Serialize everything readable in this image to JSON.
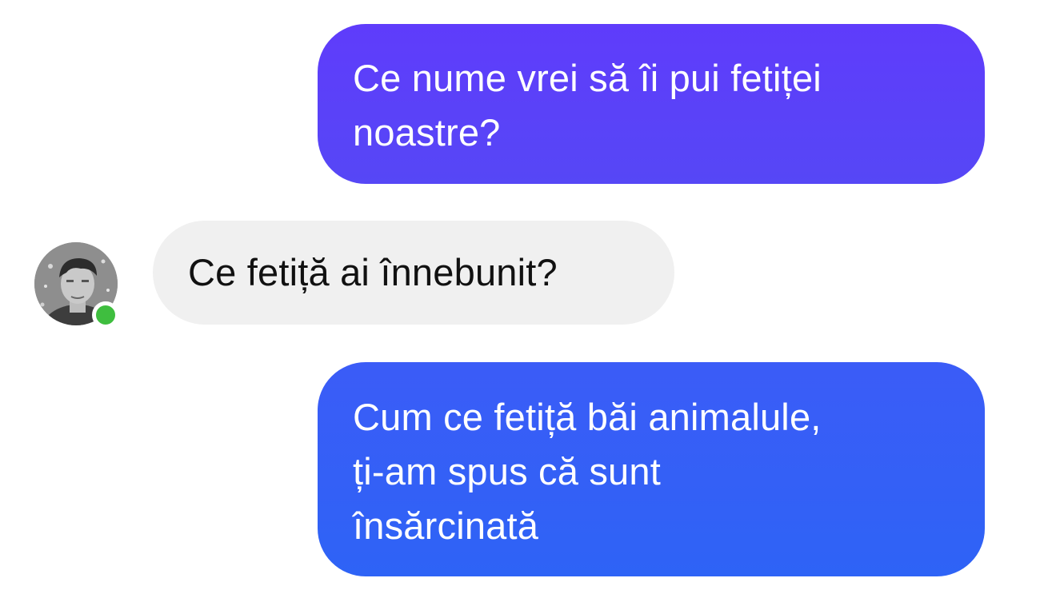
{
  "conversation": {
    "messages": [
      {
        "direction": "outgoing",
        "lines": [
          "Ce nume vrei să îi pui fetiței",
          "noastre?"
        ]
      },
      {
        "direction": "incoming",
        "lines": [
          "Ce fetiță ai înnebunit?"
        ]
      },
      {
        "direction": "outgoing",
        "lines": [
          "Cum ce fetiță băi animalule,",
          "ți-am spus că sunt",
          "însărcinată"
        ]
      }
    ]
  },
  "contact": {
    "avatar_icon": "profile-photo",
    "status": "online",
    "status_color": "#3fbe3f"
  },
  "colors": {
    "outgoing_top": "#5f3cfb",
    "outgoing_bottom": "#2e63f6",
    "incoming_bg": "#f0f0f0"
  }
}
